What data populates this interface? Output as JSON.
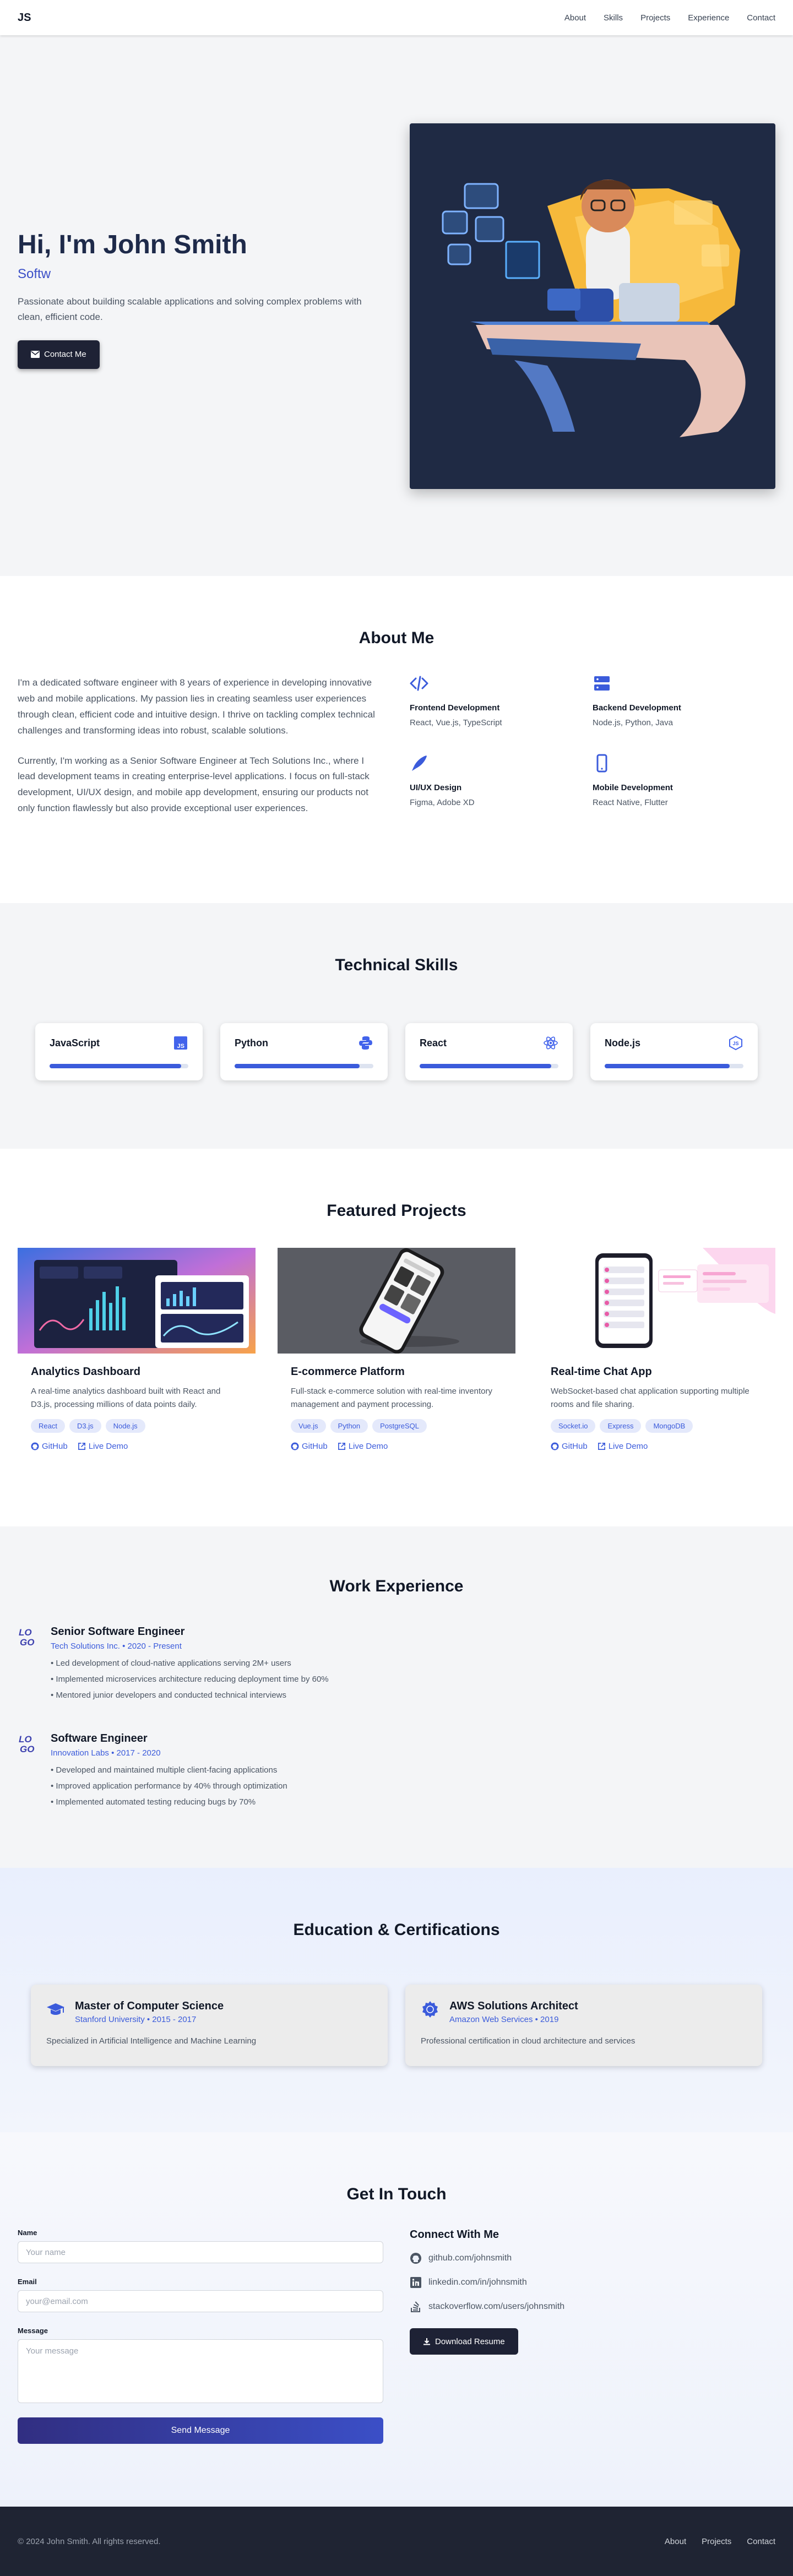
{
  "nav": {
    "logo": "JS",
    "links": [
      "About",
      "Skills",
      "Projects",
      "Experience",
      "Contact"
    ]
  },
  "hero": {
    "heading": "Hi, I'm John Smith",
    "role": "Softw",
    "tagline": "Passionate about building scalable applications and solving complex problems with clean, efficient code.",
    "cta_label": "Contact Me"
  },
  "about": {
    "title": "About Me",
    "paragraphs": [
      "I'm a dedicated software engineer with 8 years of experience in developing innovative web and mobile applications. My passion lies in creating seamless user experiences through clean, efficient code and intuitive design. I thrive on tackling complex technical challenges and transforming ideas into robust, scalable solutions.",
      "Currently, I'm working as a Senior Software Engineer at Tech Solutions Inc., where I lead development teams in creating enterprise-level applications. I focus on full-stack development, UI/UX design, and mobile app development, ensuring our products not only function flawlessly but also provide exceptional user experiences."
    ],
    "areas": [
      {
        "title": "Frontend Development",
        "desc": "React, Vue.js, TypeScript",
        "icon": "code-icon"
      },
      {
        "title": "Backend Development",
        "desc": "Node.js, Python, Java",
        "icon": "server-icon"
      },
      {
        "title": "UI/UX Design",
        "desc": "Figma, Adobe XD",
        "icon": "pen-icon"
      },
      {
        "title": "Mobile Development",
        "desc": "React Native, Flutter",
        "icon": "mobile-icon"
      }
    ]
  },
  "skills": {
    "title": "Technical Skills",
    "items": [
      {
        "name": "JavaScript",
        "level": 0.95,
        "icon": "javascript-icon"
      },
      {
        "name": "Python",
        "level": 0.9,
        "icon": "python-icon"
      },
      {
        "name": "React",
        "level": 0.95,
        "icon": "react-icon"
      },
      {
        "name": "Node.js",
        "level": 0.9,
        "icon": "nodejs-icon"
      }
    ]
  },
  "projects": {
    "title": "Featured Projects",
    "items": [
      {
        "title": "Analytics Dashboard",
        "desc": "A real-time analytics dashboard built with React and D3.js, processing millions of data points daily.",
        "tags": [
          "React",
          "D3.js",
          "Node.js"
        ],
        "github": "GitHub",
        "demo": "Live Demo"
      },
      {
        "title": "E-commerce Platform",
        "desc": "Full-stack e-commerce solution with real-time inventory management and payment processing.",
        "tags": [
          "Vue.js",
          "Python",
          "PostgreSQL"
        ],
        "github": "GitHub",
        "demo": "Live Demo"
      },
      {
        "title": "Real-time Chat App",
        "desc": "WebSocket-based chat application supporting multiple rooms and file sharing.",
        "tags": [
          "Socket.io",
          "Express",
          "MongoDB"
        ],
        "github": "GitHub",
        "demo": "Live Demo"
      }
    ]
  },
  "experience": {
    "title": "Work Experience",
    "jobs": [
      {
        "role": "Senior Software Engineer",
        "meta": "Tech Solutions Inc. • 2020 - Present",
        "points": [
          "Led development of cloud-native applications serving 2M+ users",
          "Implemented microservices architecture reducing deployment time by 60%",
          "Mentored junior developers and conducted technical interviews"
        ]
      },
      {
        "role": "Software Engineer",
        "meta": "Innovation Labs • 2017 - 2020",
        "points": [
          "Developed and maintained multiple client-facing applications",
          "Improved application performance by 40% through optimization",
          "Implemented automated testing reducing bugs by 70%"
        ]
      }
    ]
  },
  "education": {
    "title": "Education & Certifications",
    "items": [
      {
        "title": "Master of Computer Science",
        "meta": "Stanford University • 2015 - 2017",
        "desc": "Specialized in Artificial Intelligence and Machine Learning",
        "icon": "graduation-cap-icon"
      },
      {
        "title": "AWS Solutions Architect",
        "meta": "Amazon Web Services • 2019",
        "desc": "Professional certification in cloud architecture and services",
        "icon": "certificate-icon"
      }
    ]
  },
  "contact": {
    "title": "Get In Touch",
    "name_label": "Name",
    "name_placeholder": "Your name",
    "email_label": "Email",
    "email_placeholder": "your@email.com",
    "message_label": "Message",
    "message_placeholder": "Your message",
    "send_label": "Send Message",
    "connect_title": "Connect With Me",
    "socials": [
      {
        "text": "github.com/johnsmith",
        "icon": "github-icon"
      },
      {
        "text": "linkedin.com/in/johnsmith",
        "icon": "linkedin-icon"
      },
      {
        "text": "stackoverflow.com/users/johnsmith",
        "icon": "stackoverflow-icon"
      }
    ],
    "resume_label": "Download Resume"
  },
  "footer": {
    "copyright": "© 2024 John Smith. All rights reserved.",
    "links": [
      "About",
      "Projects",
      "Contact"
    ]
  },
  "colors": {
    "accent": "#3b5bdb",
    "dark": "#1e2235",
    "footer": "#1f2433"
  }
}
